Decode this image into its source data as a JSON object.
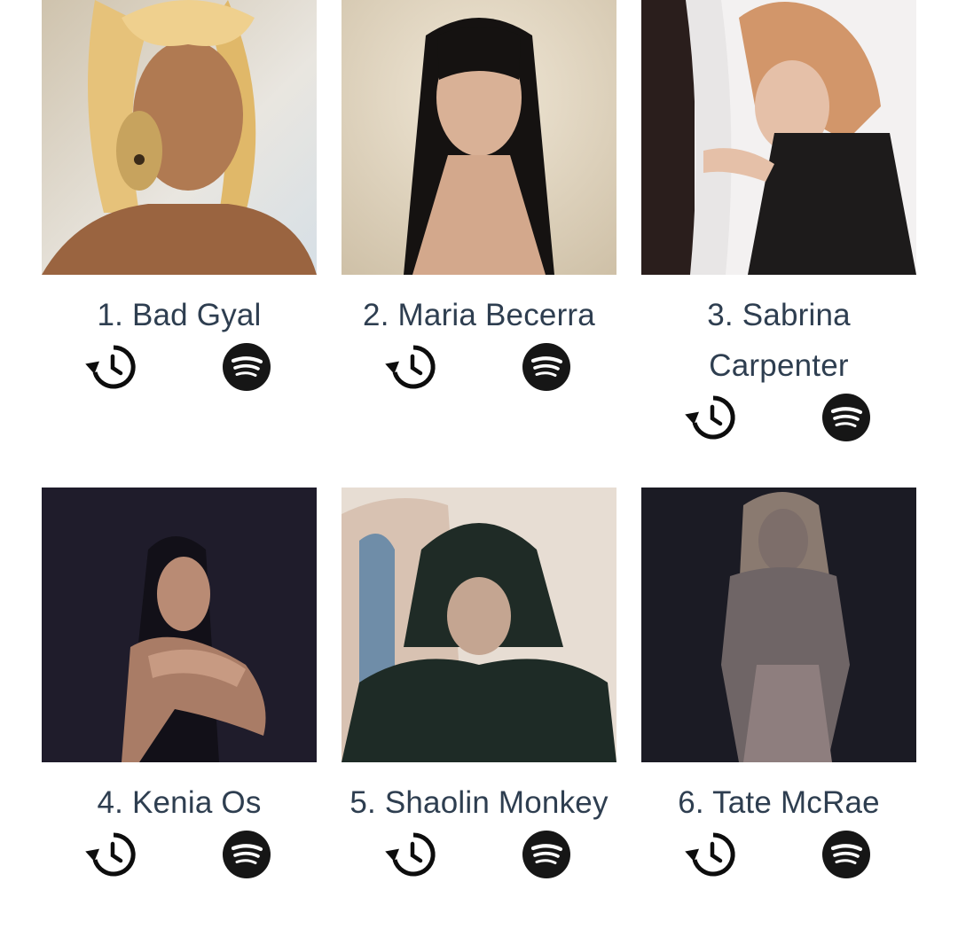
{
  "artists": [
    {
      "rank_name": "1. Bad Gyal",
      "history_icon": "history-icon",
      "spotify_icon": "spotify-icon",
      "photo_tone": [
        "#c9b79a",
        "#e8d5b0",
        "#f2e6cf"
      ]
    },
    {
      "rank_name": "2. Maria Becerra",
      "history_icon": "history-icon",
      "spotify_icon": "spotify-icon",
      "photo_tone": [
        "#d9cbb4",
        "#ece2cf",
        "#1a1716"
      ]
    },
    {
      "rank_name": "3. Sabrina Carpenter",
      "history_icon": "history-icon",
      "spotify_icon": "spotify-icon",
      "photo_tone": [
        "#f1eeee",
        "#c98a5c",
        "#1d1b1b"
      ]
    },
    {
      "rank_name": "4. Kenia Os",
      "history_icon": "history-icon",
      "spotify_icon": "spotify-icon",
      "photo_tone": [
        "#1d1a2a",
        "#2a2540",
        "#b58c77"
      ]
    },
    {
      "rank_name": "5. Shaolin Monkey",
      "history_icon": "history-icon",
      "spotify_icon": "spotify-icon",
      "photo_tone": [
        "#e6d8cc",
        "#1e2b26",
        "#c4a591"
      ]
    },
    {
      "rank_name": "6. Tate McRae",
      "history_icon": "history-icon",
      "spotify_icon": "spotify-icon",
      "photo_tone": [
        "#1b1b24",
        "#2b2a33",
        "#8e7e7e"
      ]
    }
  ]
}
